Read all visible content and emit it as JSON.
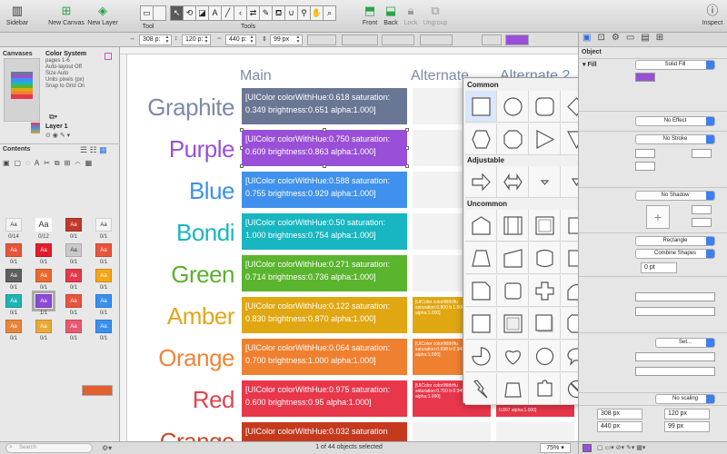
{
  "toolbar": {
    "sidebar": "Sidebar",
    "new_canvas": "New Canvas",
    "new_layer": "New Layer",
    "tool_caption": "Tool",
    "tools_caption": "Tools",
    "front": "Front",
    "back": "Back",
    "lock": "Lock",
    "ungroup": "Ungroup",
    "inspect": "Inspect"
  },
  "geometry_bar": {
    "x": "308 p:",
    "y": "120 p:",
    "w": "440 p:",
    "h": "99 px"
  },
  "sidebar": {
    "canvases_heading": "Canvases",
    "canvas_name": "Color System",
    "canvas_pages": "pages 1-6",
    "canvas_props": [
      "Auto-layout Off",
      "Size Auto",
      "Units pixels (px)",
      "Snap to Grid On"
    ],
    "layer_name": "Layer 1",
    "contents_heading": "Contents",
    "swatch_label": "Aa",
    "swatches": [
      {
        "bg": "#f2f2f2",
        "fg": "#333",
        "label": "0/14"
      },
      {
        "bg": "#ffffff",
        "fg": "#333",
        "label": "Aa",
        "big": true,
        "count": "0/12"
      },
      {
        "bg": "#c0392b",
        "fg": "#fff",
        "label": "0/1"
      },
      {
        "bg": "#f4f4f4",
        "fg": "#333",
        "label": "0/1"
      },
      {
        "bg": "#e8553c",
        "fg": "#fff",
        "label": "0/1"
      },
      {
        "bg": "#e21b2e",
        "fg": "#fff",
        "label": "0/1"
      },
      {
        "bg": "#c9c9c9",
        "fg": "#333",
        "label": "0/1"
      },
      {
        "bg": "#e8553c",
        "fg": "#fff",
        "label": "0/1"
      },
      {
        "bg": "#5e5e5e",
        "fg": "#fff",
        "label": "0/1"
      },
      {
        "bg": "#e86a2e",
        "fg": "#fff",
        "label": "0/1"
      },
      {
        "bg": "#e23a4a",
        "fg": "#fff",
        "label": "0/1"
      },
      {
        "bg": "#f4a51c",
        "fg": "#fff",
        "label": "0/1"
      },
      {
        "bg": "#1fb3b3",
        "fg": "#fff",
        "label": "0/1"
      },
      {
        "bg": "#8c4ad8",
        "fg": "#fff",
        "label": "1/1",
        "selected": true
      },
      {
        "bg": "#e8553c",
        "fg": "#fff",
        "label": "0/1"
      },
      {
        "bg": "#3a8ff0",
        "fg": "#fff",
        "label": "0/1"
      },
      {
        "bg": "#e8843a",
        "fg": "#fff",
        "label": "0/1"
      },
      {
        "bg": "#e8a93a",
        "fg": "#fff",
        "label": "0/1"
      },
      {
        "bg": "#e85a70",
        "fg": "#fff",
        "label": "0/1"
      },
      {
        "bg": "#3a8ff0",
        "fg": "#fff",
        "label": "0/1"
      }
    ],
    "search_placeholder": "Search"
  },
  "canvas": {
    "col_main": "Main",
    "col_alternate": "Alternate",
    "col_alternate2": "Alternate 2",
    "rows": [
      {
        "name": "Graphite",
        "color": "#6a7794",
        "name_color": "#7b8aa6",
        "main": "[UIColor colorWithHue:0.618 saturation: 0.349 brightness:0.651 alpha:1.000]"
      },
      {
        "name": "Purple",
        "color": "#9a4fd8",
        "name_color": "#9b4fd9",
        "main": "[UIColor colorWithHue:0.750 saturation: 0.609 brightness:0.863 alpha:1.000]"
      },
      {
        "name": "Blue",
        "color": "#3f91ed",
        "name_color": "#3d90ec",
        "main": "[UIColor colorWithHue:0.588 saturation: 0.755 brightness:0.929 alpha:1.000]"
      },
      {
        "name": "Bondi",
        "color": "#17b6c0",
        "name_color": "#1ab5bf",
        "main": "[UIColor colorWithHue:0.50 saturation: 1.000 brightness:0.754 alpha:1.000]"
      },
      {
        "name": "Green",
        "color": "#5ab42e",
        "name_color": "#5cb02f",
        "main": "[UIColor colorWithHue:0.271 saturation: 0.714 brightness:0.736 alpha:1.000]"
      },
      {
        "name": "Amber",
        "color": "#e0a712",
        "name_color": "#e1a61a",
        "main": "[UIColor colorWithHue:0.122 saturation: 0.830 brightness:0.870 alpha:1.000]",
        "alt": "[UIColor colorWithHu saturation:0.800 b 1.000 alpha:1.000]"
      },
      {
        "name": "Orange",
        "color": "#ef8030",
        "name_color": "#ef8538",
        "main": "[UIColor colorWithHue:0.064 saturation: 0.700 brightness:1.000 alpha:1.000]",
        "alt": "[UIColor colorWithHu saturation:0.698 b 0.949 alpha:1.000]"
      },
      {
        "name": "Red",
        "color": "#e8364a",
        "name_color": "#e3434f",
        "main": "[UIColor colorWithHue:0.975 saturation: 0.600 brightness:0.95 alpha:1.000]",
        "alt": "[UIColor colorWithHu saturation:0.750 b 0.949 alpha:1.000]",
        "alt2": "0.897 alpha:1.000]"
      },
      {
        "name": "Crange",
        "color": "#c53a1e",
        "name_color": "#c94a2a",
        "main": "[UIColor colorWithHue:0.032 saturation"
      }
    ]
  },
  "status": {
    "objects": "1 of 44 objects selected",
    "zoom": "75%"
  },
  "shapes": {
    "common_heading": "Common",
    "adjustable_heading": "Adjustable",
    "uncommon_heading": "Uncommon"
  },
  "inspector": {
    "object_heading": "Object",
    "fill_label": "Fill",
    "fill_value": "Solid Fill",
    "effect_value": "No Effect",
    "stroke_value": "No Stroke",
    "shadow_value": "No Shadow",
    "shape_value": "Rectangle",
    "combine_value": "Combine Shapes",
    "corner_value": "0 pt",
    "set_value": "Set...",
    "scaling_value": "No scaling",
    "geo": {
      "x": "308 px",
      "y": "120 px",
      "w": "440 px",
      "h": "99 px"
    }
  },
  "colors": {
    "accent": "#3b7ff0",
    "selection": "#9a4fd8"
  }
}
